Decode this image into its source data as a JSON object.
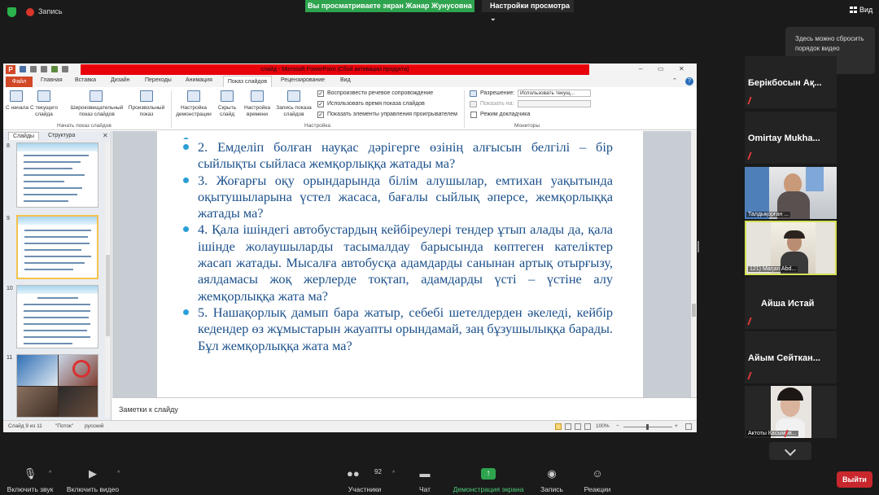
{
  "zoom": {
    "recording_label": "Запись",
    "share_banner": "Вы просматриваете экран Жанар Жунусовна",
    "view_options": "Настройки просмотра",
    "view_button": "Вид",
    "tooltip": "Здесь можно сбросить порядок видео",
    "participants": [
      {
        "name": "Берікбосын Ақ...",
        "type": "name"
      },
      {
        "name": "Omirtay  Mukha...",
        "type": "name"
      },
      {
        "name": "Талдықорған ...",
        "type": "video"
      },
      {
        "name": "121) Marjan Abd...",
        "type": "video"
      },
      {
        "name": "Айша Истай",
        "type": "name"
      },
      {
        "name": "Айым  Сейткан...",
        "type": "name"
      },
      {
        "name": "Актоты Касымов...",
        "type": "video"
      }
    ],
    "toolbar": {
      "mute": "Включить звук",
      "video": "Включить видео",
      "participants": "Участники",
      "participants_count": "92",
      "chat": "Чат",
      "share": "Демонстрация экрана",
      "record": "Запись",
      "reactions": "Реакции",
      "leave": "Выйти"
    }
  },
  "ppt": {
    "window_title": "слайд - Microsoft PowerPoint (Сбой активации продукта)",
    "tabs": [
      "Файл",
      "Главная",
      "Вставка",
      "Дизайн",
      "Переходы",
      "Анимация",
      "Показ слайдов",
      "Рецензирование",
      "Вид"
    ],
    "ribbon": {
      "from_start": "С начала",
      "from_current": "С текущего слайда",
      "broadcast": "Широковещательный показ слайдов",
      "custom_show": "Произвольный показ",
      "group_start": "Начать показ слайдов",
      "setup_show": "Настройка демонстрации",
      "hide_slide": "Скрыть слайд",
      "rehearse": "Настройка времени",
      "record_show": "Запись показа слайдов",
      "chk_narration": "Воспроизвести речевое сопровождение",
      "chk_timings": "Использовать время показа слайдов",
      "chk_controls": "Показать элементы управления проигрывателем",
      "group_setup": "Настройка",
      "resolution_label": "Разрешение:",
      "resolution_value": "Использовать текущ...",
      "show_on_label": "Показать на:",
      "presenter_view": "Режим докладчика",
      "group_monitors": "Мониторы"
    },
    "panel_tabs": [
      "Слайды",
      "Структура"
    ],
    "slide_numbers": [
      "8",
      "9",
      "10",
      "11"
    ],
    "slide_text": [
      "2. Емделіп болған науқас дәрігерге өзінің алғысын белгілі – бір сыйлықты сыйласа жемқорлыққа жатады ма?",
      "3. Жоғарғы оқу орындарында білім алушылар, емтихан уақытында оқытушыларына үстел жасаса, бағалы сыйлық әперсе, жемқорлыққа жатады ма?",
      "4. Қала ішіндегі автобустардың кейбіреулері тендер ұтып алады да, қала ішінде жолаушыларды тасымалдау барысында көптеген кателіктер жасап жатады. Мысалға автобусқа адамдарды санынан артық отырғызу, аялдамасы жоқ жерлерде тоқтап, адамдарды үсті – үстіне алу жемқорлыққа жата ма?",
      "5. Нашақорлық дамып бара жатыр, себебі шетелдерден әкеледі, кейбір кедендер өз жұмыстарын жауапты орындамай, заң бұзушылыққа барады. Бұл жемқорлыққа жата ма?"
    ],
    "notes_placeholder": "Заметки к слайду",
    "status": {
      "slide_info": "Слайд 9 из 11",
      "theme": "\"Поток\"",
      "language": "русский",
      "zoom": "100%"
    }
  }
}
